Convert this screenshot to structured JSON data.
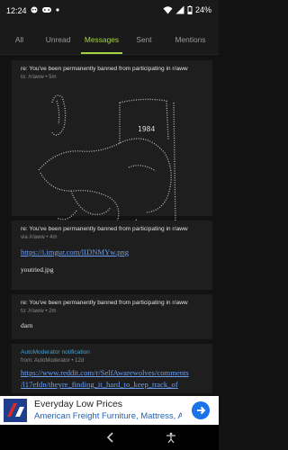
{
  "status": {
    "time": "12:24",
    "battery": "24%"
  },
  "tabs": [
    "All",
    "Unread",
    "Messages",
    "Sent",
    "Mentions"
  ],
  "active_tab": "Messages",
  "messages": [
    {
      "subject": "re: You've been permanently banned from participating in r/aww",
      "meta": "to: /r/aww • 5m",
      "ascii_text": "1984"
    },
    {
      "subject": "re: You've been permanently banned from participating in r/aww",
      "meta": "via /r/aww • 4m",
      "link": "https://i.imgur.com/lIDNMYw.png",
      "body": "youtried.jpg"
    },
    {
      "subject": "re: You've been permanently banned from participating in r/aww",
      "meta": "to: /r/aww • 2m",
      "body": "darn"
    },
    {
      "subject": "AutoModerator notification",
      "meta": "from: AutoModerator • 12d",
      "link1": "https://www.reddit.com/r/SelfAwarewolves/comments",
      "link2": "/l17efdn/theyre_finding_it_hard_to_keep_track_of"
    }
  ],
  "ad": {
    "title": "Everyday Low Prices",
    "subtitle": "American Freight Furniture, Mattress, App..."
  },
  "colors": {
    "accent": "#a5d243",
    "link": "#6d9ff5",
    "notification": "#40a4d8"
  }
}
